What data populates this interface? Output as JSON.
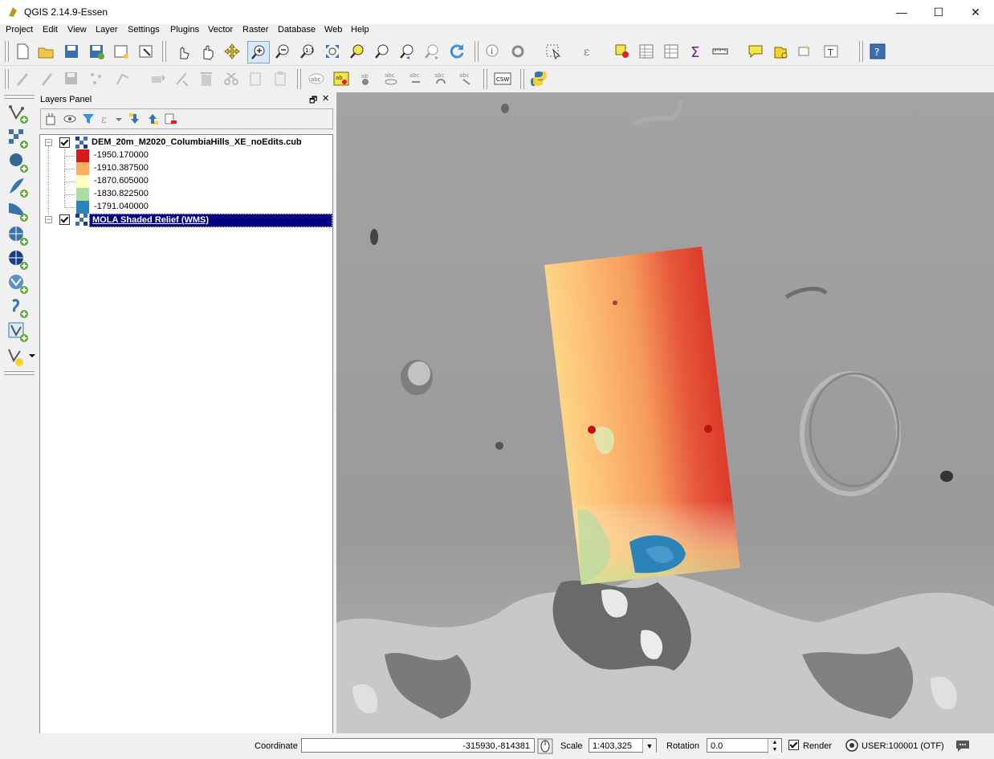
{
  "window": {
    "title": "QGIS 2.14.9-Essen",
    "minimize_glyph": "—",
    "maximize_glyph": "☐",
    "close_glyph": "✕"
  },
  "menubar": {
    "items": [
      {
        "label": "Project",
        "accel": "P"
      },
      {
        "label": "Edit",
        "accel": "E"
      },
      {
        "label": "View",
        "accel": "V"
      },
      {
        "label": "Layer",
        "accel": "L"
      },
      {
        "label": "Settings",
        "accel": "S"
      },
      {
        "label": "Plugins",
        "accel": "P"
      },
      {
        "label": "Vector",
        "accel": "o"
      },
      {
        "label": "Raster",
        "accel": "R"
      },
      {
        "label": "Database",
        "accel": "D"
      },
      {
        "label": "Web",
        "accel": "W"
      },
      {
        "label": "Help",
        "accel": "H"
      }
    ]
  },
  "toolbar_icons_row1": [
    "new-project-icon",
    "open-project-icon",
    "save-project-icon",
    "save-as-icon",
    "new-print-composer-icon",
    "composer-manager-icon",
    "touch-zoom-pan-icon",
    "pan-map-icon",
    "pan-to-selection-icon",
    "zoom-in-icon",
    "zoom-out-icon",
    "zoom-native-icon",
    "zoom-full-icon",
    "zoom-to-selection-icon",
    "zoom-to-layer-icon",
    "zoom-last-icon",
    "zoom-next-icon",
    "refresh-icon",
    "identify-icon",
    "action-icon",
    "select-features-icon",
    "select-expression-icon",
    "deselect-icon",
    "attribute-table-icon",
    "field-calculator-icon",
    "statistics-icon",
    "measure-icon",
    "map-tips-icon",
    "new-bookmark-icon",
    "show-bookmarks-icon",
    "text-annotation-icon",
    "help-icon"
  ],
  "toolbar_icons_row2": [
    "current-edits-icon",
    "toggle-editing-icon",
    "save-edits-icon",
    "add-feature-icon",
    "node-tool-icon",
    "move-feature-icon",
    "delete-selected-icon",
    "cut-features-icon",
    "copy-features-icon",
    "paste-features-icon",
    "label-icon",
    "layer-labeling-icon",
    "pin-labels-icon",
    "show-hide-labels-icon",
    "move-label-icon",
    "rotate-label-icon",
    "change-label-icon",
    "csw-icon",
    "python-icon"
  ],
  "csw_label": "CSW",
  "help_label": "?",
  "left_toolbar_icons": [
    "add-vector-layer-icon",
    "add-raster-layer-icon",
    "add-postgis-layer-icon",
    "add-spatialite-layer-icon",
    "add-mssql-layer-icon",
    "add-wms-layer-icon",
    "add-wcs-layer-icon",
    "add-wfs-layer-icon",
    "add-delimited-text-icon",
    "add-virtual-layer-icon",
    "new-layer-icon"
  ],
  "layers_panel": {
    "title": "Layers Panel",
    "float_glyph": "🗗",
    "close_glyph": "✕",
    "layers": [
      {
        "name": "DEM_20m_M2020_ColumbiaHills_XE_noEdits.cub",
        "checked": true,
        "expanded": true,
        "selected": false,
        "legend": [
          {
            "label": "-1950.170000",
            "color": "#d7191c"
          },
          {
            "label": "-1910.387500",
            "color": "#fdae61"
          },
          {
            "label": "-1870.605000",
            "color": "#ffffbf"
          },
          {
            "label": "-1830.822500",
            "color": "#abdda4"
          },
          {
            "label": "-1791.040000",
            "color": "#2b83ba"
          }
        ]
      },
      {
        "name": "MOLA Shaded Relief (WMS)",
        "checked": true,
        "expanded": true,
        "selected": true,
        "legend": []
      }
    ]
  },
  "statusbar": {
    "coordinate_label": "Coordinate",
    "coordinate_value": "-315930,-814381",
    "scale_label": "Scale",
    "scale_value": "1:403,325",
    "rotation_label": "Rotation",
    "rotation_value": "0.0",
    "render_label": "Render",
    "render_checked": true,
    "crs_label": "USER:100001 (OTF)"
  },
  "colors": {
    "selection": "#000080",
    "canvas_bg": "#9a9a9a"
  }
}
